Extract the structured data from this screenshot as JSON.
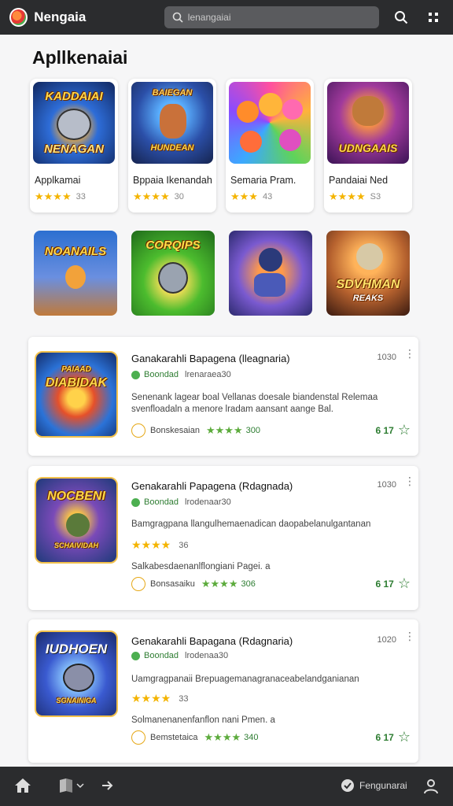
{
  "header": {
    "app_title": "Nengaia",
    "search_placeholder": "lenangaiai",
    "icons": [
      "app-logo-icon",
      "search-icon",
      "grid-menu-icon"
    ]
  },
  "section": {
    "title": "Apllkenaiai"
  },
  "tiles": [
    {
      "name": "Applkamai",
      "stars": "★★★★",
      "rating": "33",
      "art_text": "KADDAIAI",
      "art_text2": "NENAGAN",
      "bg": "#1c3f8f"
    },
    {
      "name": "Bppaia Ikenandah",
      "stars": "★★★★",
      "rating": "30",
      "art_text": "BAIEGAN",
      "art_text2": "HUNDEAN",
      "bg": "#2a3c7a"
    },
    {
      "name": "Semaria Pram.",
      "stars": "★★★",
      "rating": "43",
      "art_text": "",
      "art_text2": "",
      "bg": "#7b3fc4"
    },
    {
      "name": "Pandaiai Ned",
      "stars": "★★★★",
      "rating": "S3",
      "art_text": "",
      "art_text2": "UDNGAAIS",
      "bg": "#4a1f6b"
    }
  ],
  "tiles_row2": [
    {
      "art_text": "NOANAILS",
      "bg": "#2b5aa8"
    },
    {
      "art_text": "CORQIPS",
      "bg": "#3f9a2e"
    },
    {
      "art_text": "",
      "bg": "#5a4aa8"
    },
    {
      "art_text": "SDVHMAN",
      "art_text2": "REAKS",
      "bg": "#6a3a1a"
    }
  ],
  "cards": [
    {
      "title": "Ganakarahli Bapagena (lleagnaria)",
      "time": "1030",
      "verified": "Boondad",
      "verified_sub": "lrenaraea30",
      "desc": "Senenank lagear boal Vellanas doesale biandenstal Relemaa svenfloadaln a menore lradam aansant aange Bal.",
      "meta_label": "Bonskesaian",
      "meta_stars": "★★★★",
      "meta_num": "300",
      "price": "6 17",
      "art_text": "DIABIDAK",
      "art_top": "PAIAAD"
    },
    {
      "title": "Genakarahli Papagena (Rdagnada)",
      "time": "1030",
      "verified": "Boondad",
      "verified_sub": "lrodenaar30",
      "desc": "Bamgragpana llangulhemaenadican daopabelanulgantanan",
      "big_stars": "★★★★",
      "big_num": "36",
      "line": "Salkabesdaenanlflongiani Pagei. a",
      "meta_label": "Bonsasaiku",
      "meta_stars": "★★★★",
      "meta_num": "306",
      "price": "6 17",
      "art_text": "NOCBENI",
      "art_top": "SCHAIVIDAH"
    },
    {
      "title": "Genakarahli Bapagana (Rdagnaria)",
      "time": "1020",
      "verified": "Boondad",
      "verified_sub": "lrodenaa30",
      "desc": "Uamgragpanaii Brepuagemanagranaceabelandganianan",
      "big_stars": "★★★★",
      "big_num": "33",
      "line": "Solmanenanenfanflon nani Pmen. a",
      "meta_label": "Bemstetaica",
      "meta_stars": "★★★★",
      "meta_num": "340",
      "price": "6 17",
      "art_text": "IUDHOEN",
      "art_top": "SGNAINIGA"
    }
  ],
  "bottom_nav": {
    "account_label": "Fengunarai"
  }
}
